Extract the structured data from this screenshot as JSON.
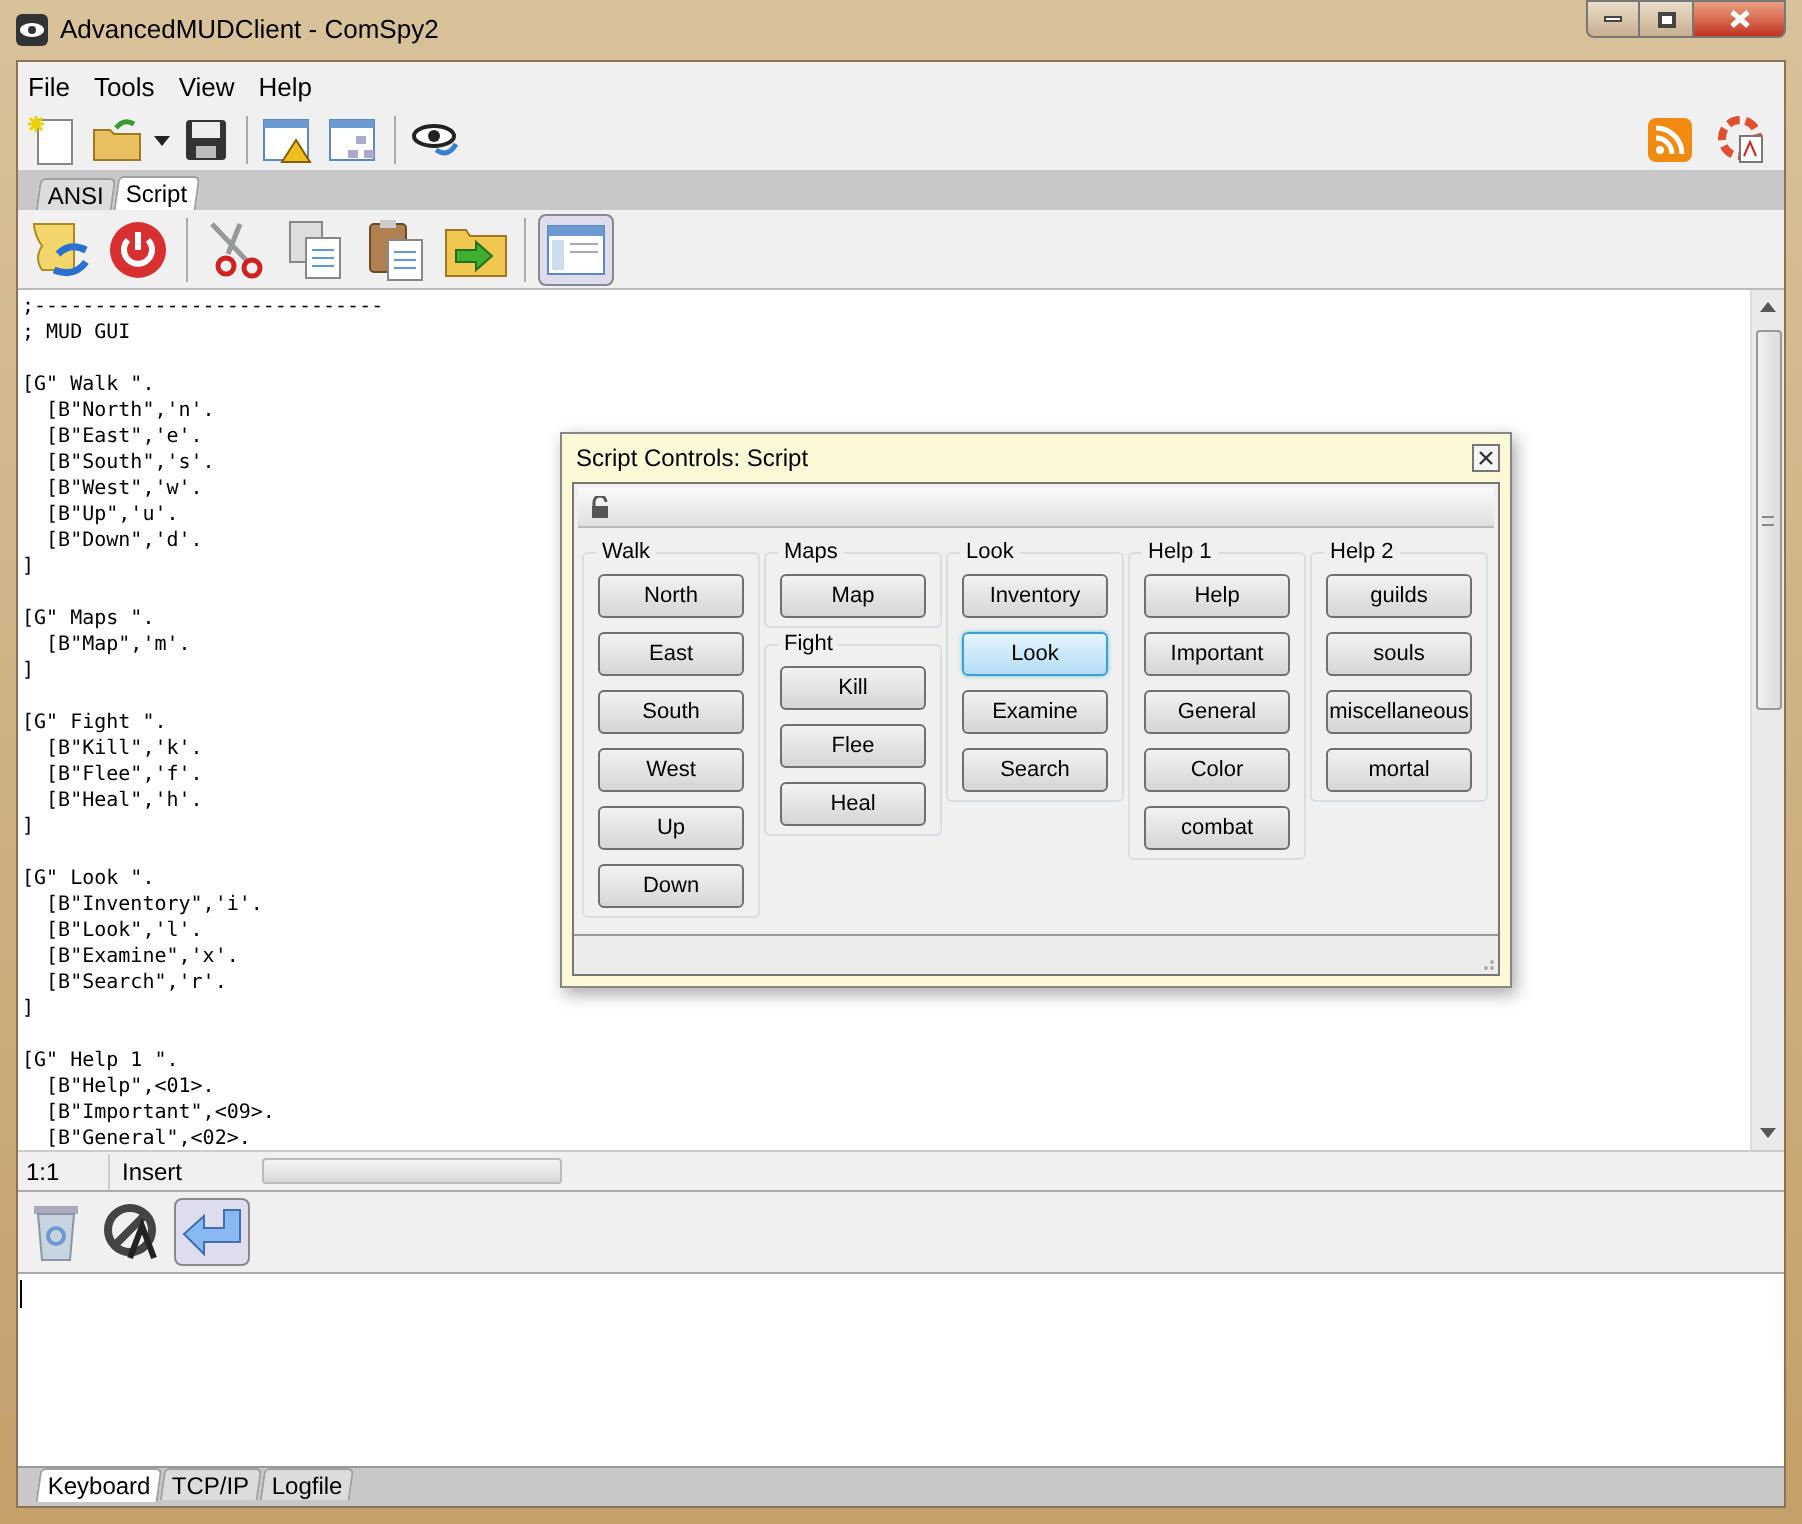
{
  "window": {
    "title": "AdvancedMUDClient - ComSpy2"
  },
  "menu": [
    "File",
    "Tools",
    "View",
    "Help"
  ],
  "tabs": [
    {
      "label": "ANSI",
      "selected": false
    },
    {
      "label": "Script",
      "selected": true
    }
  ],
  "editor": {
    "blocks": [
      [
        ";-----------------------------",
        "; MUD GUI"
      ],
      [
        "[G\" Walk \".",
        "  [B\"North\",'n'.",
        "  [B\"East\",'e'.",
        "  [B\"South\",'s'.",
        "  [B\"West\",'w'.",
        "  [B\"Up\",'u'.",
        "  [B\"Down\",'d'.",
        "]"
      ],
      [
        "[G\" Maps \".",
        "  [B\"Map\",'m'.",
        "]"
      ],
      [
        "[G\" Fight \".",
        "  [B\"Kill\",'k'.",
        "  [B\"Flee\",'f'.",
        "  [B\"Heal\",'h'.",
        "]"
      ],
      [
        "[G\" Look \".",
        "  [B\"Inventory\",'i'.",
        "  [B\"Look\",'l'.",
        "  [B\"Examine\",'x'.",
        "  [B\"Search\",'r'.",
        "]"
      ],
      [
        "[G\" Help 1 \".",
        "  [B\"Help\",<01>.",
        "  [B\"Important\",<09>.",
        "  [B\"General\",<02>."
      ]
    ]
  },
  "status_bar": {
    "position": "1:1",
    "mode": "Insert"
  },
  "dialog": {
    "title": "Script Controls: Script",
    "columns": [
      [
        {
          "title": "Walk",
          "buttons": [
            {
              "label": "North",
              "focused": false
            },
            {
              "label": "East",
              "focused": false
            },
            {
              "label": "South",
              "focused": false
            },
            {
              "label": "West",
              "focused": false
            },
            {
              "label": "Up",
              "focused": false
            },
            {
              "label": "Down",
              "focused": false
            }
          ]
        }
      ],
      [
        {
          "title": "Maps",
          "buttons": [
            {
              "label": "Map",
              "focused": false
            }
          ]
        },
        {
          "title": "Fight",
          "buttons": [
            {
              "label": "Kill",
              "focused": false
            },
            {
              "label": "Flee",
              "focused": false
            },
            {
              "label": "Heal",
              "focused": false
            }
          ]
        }
      ],
      [
        {
          "title": "Look",
          "buttons": [
            {
              "label": "Inventory",
              "focused": false
            },
            {
              "label": "Look",
              "focused": true
            },
            {
              "label": "Examine",
              "focused": false
            },
            {
              "label": "Search",
              "focused": false
            }
          ]
        }
      ],
      [
        {
          "title": "Help 1",
          "buttons": [
            {
              "label": "Help",
              "focused": false
            },
            {
              "label": "Important",
              "focused": false
            },
            {
              "label": "General",
              "focused": false
            },
            {
              "label": "Color",
              "focused": false
            },
            {
              "label": "combat",
              "focused": false
            }
          ]
        }
      ],
      [
        {
          "title": "Help 2",
          "buttons": [
            {
              "label": "guilds",
              "focused": false
            },
            {
              "label": "souls",
              "focused": false
            },
            {
              "label": "miscellaneous",
              "focused": false
            },
            {
              "label": "mortal",
              "focused": false
            }
          ]
        }
      ]
    ]
  },
  "bottom_tabs": [
    {
      "label": "Keyboard",
      "selected": true
    },
    {
      "label": "TCP/IP",
      "selected": false
    },
    {
      "label": "Logfile",
      "selected": false
    }
  ]
}
